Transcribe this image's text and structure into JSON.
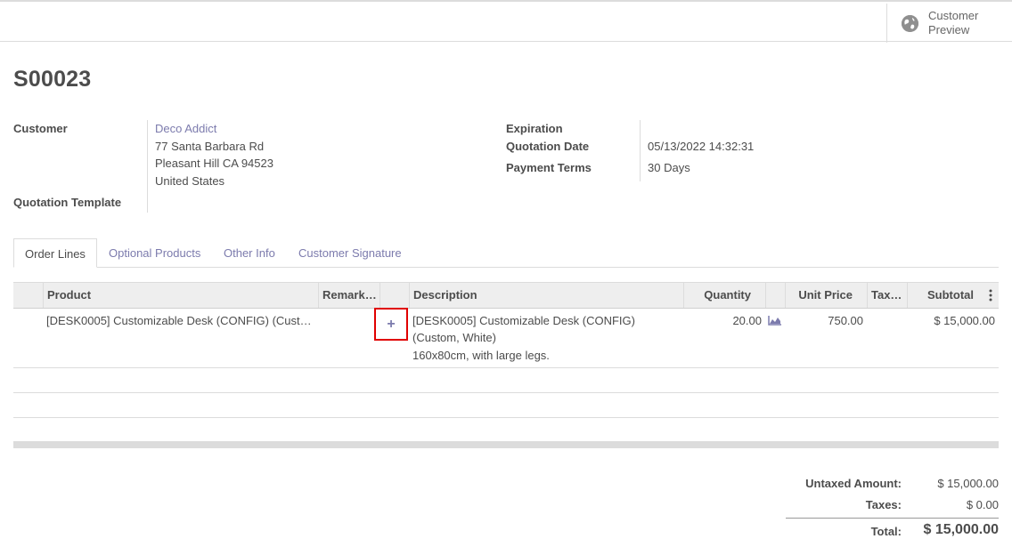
{
  "header": {
    "customer_preview_label": "Customer Preview"
  },
  "record": {
    "title": "S00023"
  },
  "form": {
    "customer_label": "Customer",
    "customer_name": "Deco Addict",
    "address_line1": "77 Santa Barbara Rd",
    "address_line2": "Pleasant Hill CA 94523",
    "address_line3": "United States",
    "quotation_template_label": "Quotation Template",
    "expiration_label": "Expiration",
    "expiration_value": "",
    "quotation_date_label": "Quotation Date",
    "quotation_date_value": "05/13/2022 14:32:31",
    "payment_terms_label": "Payment Terms",
    "payment_terms_value": "30 Days"
  },
  "tabs": [
    {
      "label": "Order Lines",
      "active": true
    },
    {
      "label": "Optional Products",
      "active": false
    },
    {
      "label": "Other Info",
      "active": false
    },
    {
      "label": "Customer Signature",
      "active": false
    }
  ],
  "table": {
    "columns": [
      "Product",
      "Remark…",
      "Description",
      "Quantity",
      "Unit Price",
      "Tax…",
      "Subtotal"
    ],
    "rows": [
      {
        "product": "[DESK0005] Customizable Desk (CONFIG) (Cust…",
        "remark_icon": "+",
        "description_line1": "[DESK0005] Customizable Desk (CONFIG)",
        "description_line2": "(Custom, White)",
        "description_line3": "160x80cm, with large legs.",
        "quantity": "20.00",
        "unit_price": "750.00",
        "taxes": "",
        "subtotal": "$ 15,000.00"
      }
    ]
  },
  "totals": {
    "untaxed_label": "Untaxed Amount:",
    "untaxed_value": "$ 15,000.00",
    "taxes_label": "Taxes:",
    "taxes_value": "$ 0.00",
    "total_label": "Total:",
    "total_value": "$ 15,000.00"
  },
  "icons": {
    "globe": "globe-icon",
    "forecast": "area-chart-icon",
    "column_options": "vertical-dots-icon",
    "add_line": "plus-icon"
  },
  "colors": {
    "link": "#7c7bad",
    "highlight": "#e00000"
  }
}
